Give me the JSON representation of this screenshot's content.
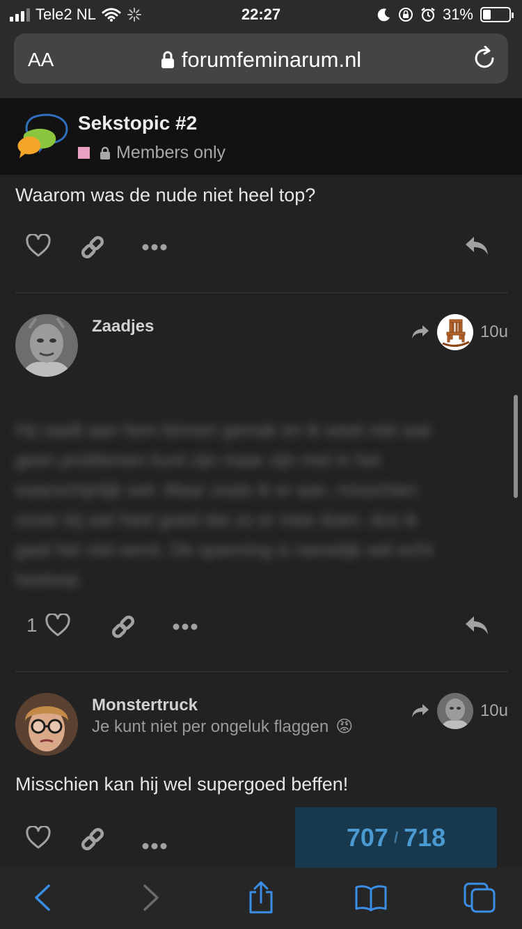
{
  "status_bar": {
    "carrier": "Tele2 NL",
    "time": "22:27",
    "battery_percent": "31%",
    "battery_level": 0.31
  },
  "browser": {
    "text_size_label": "AA",
    "url": "forumfeminarum.nl"
  },
  "topic": {
    "title": "Sekstopic #2",
    "category_color": "#e8a1c0",
    "access_label": "Members only"
  },
  "posts": [
    {
      "text": "Waarom was de nude niet heel top?",
      "like_count": ""
    },
    {
      "username": "Zaadjes",
      "time": "10u",
      "reply_to_avatar": "rocking-chair-avatar",
      "like_count": "1",
      "blurred_lines": [
        "Hij raadt aan hem binnen gemak en ik weet niet wat",
        "geen problemen kunt zijn maar zijn met in het",
        "waarschijnlijk wel. Maar zoals ik er aan, misschien",
        "zover bij wel heel goed dat zo er mee doen. dus ik",
        "gaat het niet eerst. De spanning is namelijk wel echt",
        "heelwat."
      ]
    },
    {
      "username": "Monstertruck",
      "user_title": "Je kunt niet per ongeluk flaggen",
      "user_title_emoji": "😡",
      "time": "10u",
      "reply_to_avatar": "zaadjes-avatar",
      "text": "Misschien kan hij wel supergoed beffen!"
    }
  ],
  "progress": {
    "current": "707",
    "separator": "/",
    "total": "718"
  },
  "colors": {
    "accent_blue": "#4a9ad1",
    "background": "#222222",
    "header_background": "#121212"
  }
}
